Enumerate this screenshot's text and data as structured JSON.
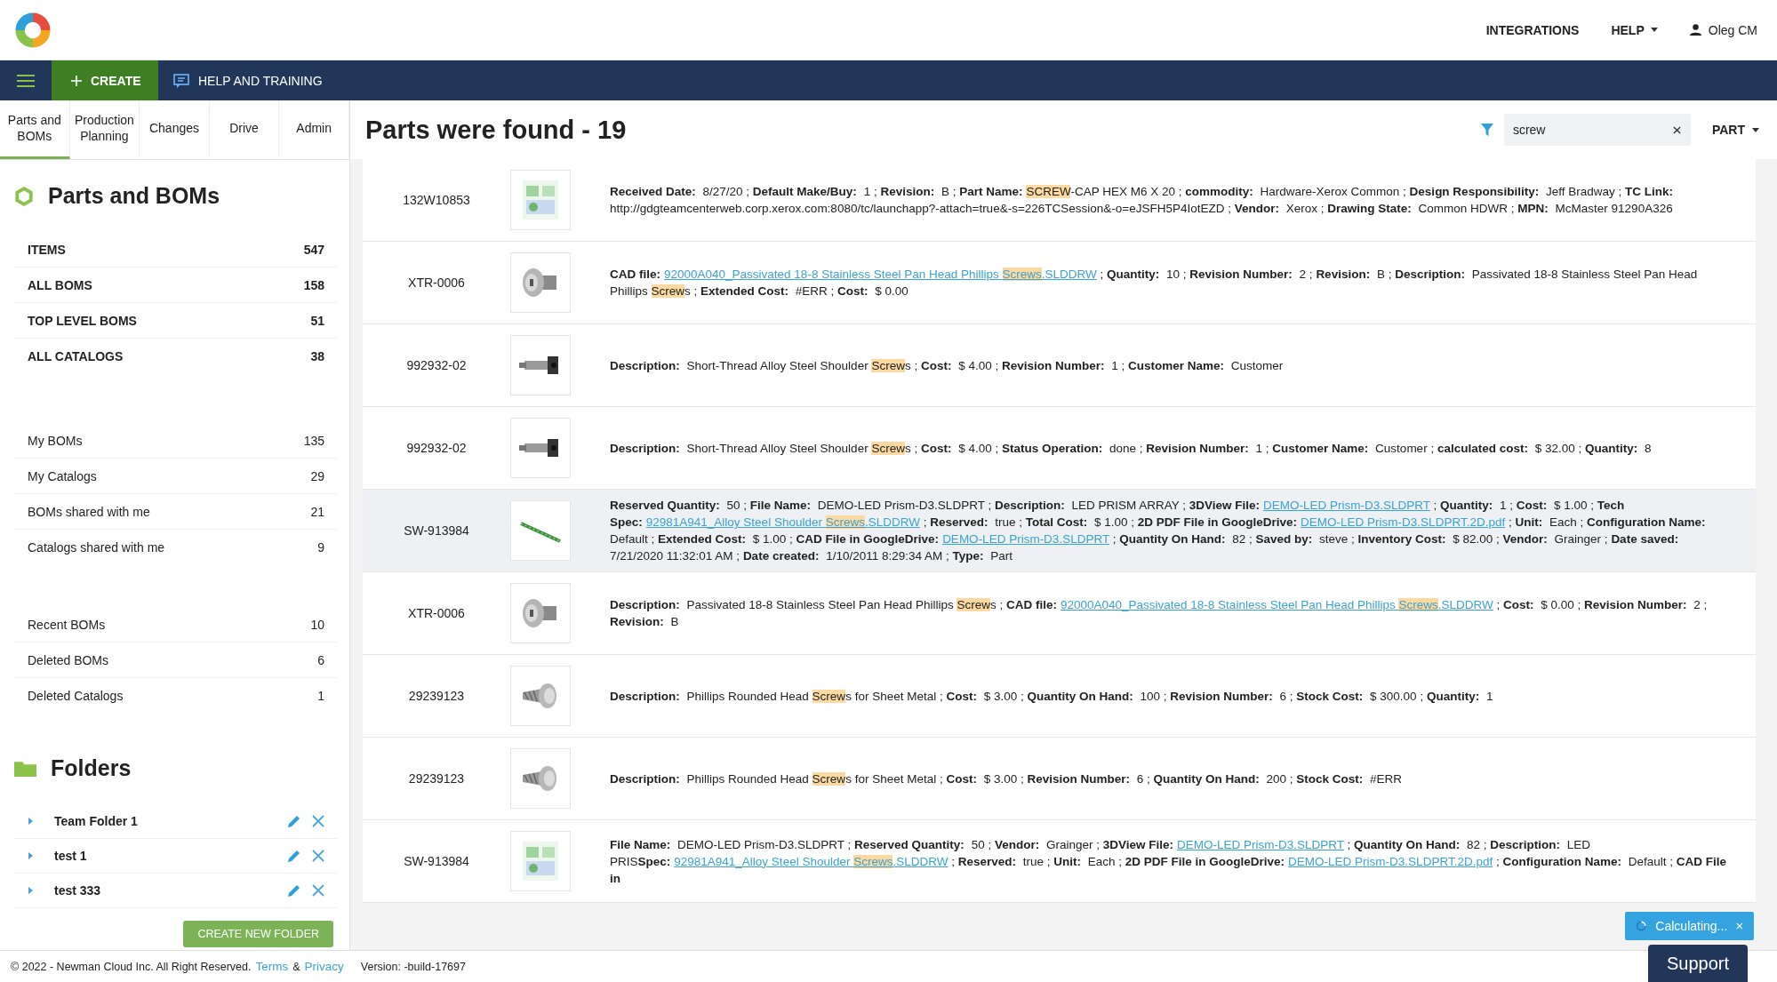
{
  "header": {
    "nav": [
      {
        "label": "INTEGRATIONS",
        "caret": false
      },
      {
        "label": "HELP",
        "caret": true
      }
    ],
    "user": "Oleg CM"
  },
  "toolbar": {
    "create": "CREATE",
    "help": "HELP AND TRAINING"
  },
  "tabs": [
    {
      "label": "Parts and BOMs",
      "selected": true
    },
    {
      "label": "Production Planning",
      "selected": false
    },
    {
      "label": "Changes",
      "selected": false
    },
    {
      "label": "Drive",
      "selected": false
    },
    {
      "label": "Admin",
      "selected": false
    }
  ],
  "sidebar": {
    "title": "Parts and BOMs",
    "groups": [
      {
        "kind": "main",
        "items": [
          {
            "label": "ITEMS",
            "count": "547"
          },
          {
            "label": "ALL BOMS",
            "count": "158"
          },
          {
            "label": "TOP LEVEL BOMS",
            "count": "51"
          },
          {
            "label": "ALL CATALOGS",
            "count": "38"
          }
        ]
      },
      {
        "kind": "plain",
        "items": [
          {
            "label": "My BOMs",
            "count": "135"
          },
          {
            "label": "My Catalogs",
            "count": "29"
          },
          {
            "label": "BOMs shared with me",
            "count": "21"
          },
          {
            "label": "Catalogs shared with me",
            "count": "9"
          }
        ]
      },
      {
        "kind": "plain",
        "items": [
          {
            "label": "Recent BOMs",
            "count": "10"
          },
          {
            "label": "Deleted BOMs",
            "count": "6"
          },
          {
            "label": "Deleted Catalogs",
            "count": "1"
          }
        ]
      }
    ],
    "folders_title": "Folders",
    "folders": [
      {
        "name": "Team Folder 1"
      },
      {
        "name": "test 1"
      },
      {
        "name": "test 333"
      }
    ],
    "create_folder": "CREATE NEW FOLDER"
  },
  "results": {
    "title": "Parts were found - 19",
    "search": "screw",
    "type": "PART",
    "rows": [
      {
        "number": "132W10853",
        "selected": false,
        "details": [
          {
            "kind": "label",
            "text": "Received Date:"
          },
          {
            "kind": "text",
            "text": " 8/27/20 ; "
          },
          {
            "kind": "label",
            "text": "Default Make/Buy:"
          },
          {
            "kind": "text",
            "text": " 1 ; "
          },
          {
            "kind": "label",
            "text": "Revision:"
          },
          {
            "kind": "text",
            "text": " B ; "
          },
          {
            "kind": "label",
            "text": "Part Name:"
          },
          {
            "kind": "hl",
            "text": "SCREW"
          },
          {
            "kind": "text",
            "text": "-CAP HEX M6 X 20 ; "
          },
          {
            "kind": "label",
            "text": "commodity:"
          },
          {
            "kind": "text",
            "text": " Hardware-Xerox Common ; "
          },
          {
            "kind": "label",
            "text": "Design Responsibility:"
          },
          {
            "kind": "text",
            "text": " Jeff Bradway ; "
          },
          {
            "kind": "label",
            "text": "TC Link:"
          },
          {
            "kind": "text",
            "text": " http://gdgteamcenterweb.corp.xerox.com:8080/tc/launchapp?-attach=true&-s=226TCSession&-o=eJSFH5P4IotEZD ; "
          },
          {
            "kind": "label",
            "text": "Vendor:"
          },
          {
            "kind": "text",
            "text": " Xerox ; "
          },
          {
            "kind": "label",
            "text": "Drawing State:"
          },
          {
            "kind": "text",
            "text": " Common HDWR ; "
          },
          {
            "kind": "label",
            "text": "MPN:"
          },
          {
            "kind": "text",
            "text": " McMaster 91290A326"
          }
        ]
      },
      {
        "number": "XTR-0006",
        "selected": false,
        "details": [
          {
            "kind": "label",
            "text": "CAD file:"
          },
          {
            "kind": "link",
            "parts": [
              {
                "text": "92000A040_Passivated 18-8 Stainless Steel Pan Head Phillips ",
                "highlight": false
              },
              {
                "text": "Screws",
                "highlight": true
              },
              {
                "text": ".SLDDRW",
                "highlight": false
              }
            ]
          },
          {
            "kind": "text",
            "text": " ; "
          },
          {
            "kind": "label",
            "text": "Quantity:"
          },
          {
            "kind": "text",
            "text": " 10 ; "
          },
          {
            "kind": "label",
            "text": "Revision Number:"
          },
          {
            "kind": "text",
            "text": " 2 ; "
          },
          {
            "kind": "label",
            "text": "Revision:"
          },
          {
            "kind": "text",
            "text": " B ; "
          },
          {
            "kind": "label",
            "text": "Description:"
          },
          {
            "kind": "text",
            "text": " Passivated 18-8 Stainless Steel Pan Head Phillips "
          },
          {
            "kind": "hl",
            "text": "Screw"
          },
          {
            "kind": "text",
            "text": "s ; "
          },
          {
            "kind": "label",
            "text": "Extended Cost:"
          },
          {
            "kind": "text",
            "text": " #ERR ; "
          },
          {
            "kind": "label",
            "text": "Cost:"
          },
          {
            "kind": "text",
            "text": " $ 0.00"
          }
        ]
      },
      {
        "number": "992932-02",
        "selected": false,
        "details": [
          {
            "kind": "label",
            "text": "Description:"
          },
          {
            "kind": "text",
            "text": " Short-Thread Alloy Steel Shoulder "
          },
          {
            "kind": "hl",
            "text": "Screw"
          },
          {
            "kind": "text",
            "text": "s ; "
          },
          {
            "kind": "label",
            "text": "Cost:"
          },
          {
            "kind": "text",
            "text": " $ 4.00 ; "
          },
          {
            "kind": "label",
            "text": "Revision Number:"
          },
          {
            "kind": "text",
            "text": " 1 ; "
          },
          {
            "kind": "label",
            "text": "Customer Name:"
          },
          {
            "kind": "text",
            "text": " Customer"
          }
        ]
      },
      {
        "number": "992932-02",
        "selected": false,
        "details": [
          {
            "kind": "label",
            "text": "Description:"
          },
          {
            "kind": "text",
            "text": " Short-Thread Alloy Steel Shoulder "
          },
          {
            "kind": "hl",
            "text": "Screw"
          },
          {
            "kind": "text",
            "text": "s ; "
          },
          {
            "kind": "label",
            "text": "Cost:"
          },
          {
            "kind": "text",
            "text": " $ 4.00 ; "
          },
          {
            "kind": "label",
            "text": "Status Operation:"
          },
          {
            "kind": "text",
            "text": " done ; "
          },
          {
            "kind": "label",
            "text": "Revision Number:"
          },
          {
            "kind": "text",
            "text": " 1 ; "
          },
          {
            "kind": "label",
            "text": "Customer Name:"
          },
          {
            "kind": "text",
            "text": " Customer ; "
          },
          {
            "kind": "label",
            "text": "calculated cost:"
          },
          {
            "kind": "text",
            "text": " $ 32.00 ; "
          },
          {
            "kind": "label",
            "text": "Quantity:"
          },
          {
            "kind": "text",
            "text": " 8"
          }
        ]
      },
      {
        "number": "SW-913984",
        "selected": true,
        "details": [
          {
            "kind": "label",
            "text": "Reserved Quantity:"
          },
          {
            "kind": "text",
            "text": " 50 ; "
          },
          {
            "kind": "label",
            "text": "File Name:"
          },
          {
            "kind": "text",
            "text": " DEMO-LED Prism-D3.SLDPRT ; "
          },
          {
            "kind": "label",
            "text": "Description:"
          },
          {
            "kind": "text",
            "text": " LED PRISM ARRAY ; "
          },
          {
            "kind": "label",
            "text": "3DView File:"
          },
          {
            "kind": "link",
            "parts": [
              {
                "text": "DEMO-LED Prism-D3.SLDPRT",
                "highlight": false
              }
            ]
          },
          {
            "kind": "text",
            "text": " ; "
          },
          {
            "kind": "label",
            "text": "Quantity:"
          },
          {
            "kind": "text",
            "text": " 1 ; "
          },
          {
            "kind": "label",
            "text": "Cost:"
          },
          {
            "kind": "text",
            "text": " $ 1.00 ; "
          },
          {
            "kind": "label",
            "text": "Tech Spec:"
          },
          {
            "kind": "link",
            "parts": [
              {
                "text": "92981A941_Alloy Steel Shoulder ",
                "highlight": false
              },
              {
                "text": "Screws",
                "highlight": true
              },
              {
                "text": ".SLDDRW",
                "highlight": false
              }
            ]
          },
          {
            "kind": "text",
            "text": " ; "
          },
          {
            "kind": "label",
            "text": "Reserved:"
          },
          {
            "kind": "text",
            "text": " true ; "
          },
          {
            "kind": "label",
            "text": "Total Cost:"
          },
          {
            "kind": "text",
            "text": " $ 1.00 ; "
          },
          {
            "kind": "label",
            "text": "2D PDF File in GoogleDrive:"
          },
          {
            "kind": "link",
            "parts": [
              {
                "text": "DEMO-LED Prism-D3.SLDPRT.2D.pdf",
                "highlight": false
              }
            ]
          },
          {
            "kind": "text",
            "text": " ; "
          },
          {
            "kind": "label",
            "text": "Unit:"
          },
          {
            "kind": "text",
            "text": " Each ; "
          },
          {
            "kind": "label",
            "text": "Configuration Name:"
          },
          {
            "kind": "text",
            "text": " Default ; "
          },
          {
            "kind": "label",
            "text": "Extended Cost:"
          },
          {
            "kind": "text",
            "text": " $ 1.00 ; "
          },
          {
            "kind": "label",
            "text": "CAD File in GoogleDrive:"
          },
          {
            "kind": "link",
            "parts": [
              {
                "text": "DEMO-LED Prism-D3.SLDPRT",
                "highlight": false
              }
            ]
          },
          {
            "kind": "text",
            "text": " ; "
          },
          {
            "kind": "label",
            "text": "Quantity On Hand:"
          },
          {
            "kind": "text",
            "text": " 82 ; "
          },
          {
            "kind": "label",
            "text": "Saved by:"
          },
          {
            "kind": "text",
            "text": " steve ; "
          },
          {
            "kind": "label",
            "text": "Inventory Cost:"
          },
          {
            "kind": "text",
            "text": " $ 82.00 ; "
          },
          {
            "kind": "label",
            "text": "Vendor:"
          },
          {
            "kind": "text",
            "text": " Grainger ; "
          },
          {
            "kind": "label",
            "text": "Date saved:"
          },
          {
            "kind": "text",
            "text": " 7/21/2020 11:32:01 AM ; "
          },
          {
            "kind": "label",
            "text": "Date created:"
          },
          {
            "kind": "text",
            "text": " 1/10/2011 8:29:34 AM ; "
          },
          {
            "kind": "label",
            "text": "Type:"
          },
          {
            "kind": "text",
            "text": " Part"
          }
        ]
      },
      {
        "number": "XTR-0006",
        "selected": false,
        "details": [
          {
            "kind": "label",
            "text": "Description:"
          },
          {
            "kind": "text",
            "text": " Passivated 18-8 Stainless Steel Pan Head Phillips "
          },
          {
            "kind": "hl",
            "text": "Screw"
          },
          {
            "kind": "text",
            "text": "s ; "
          },
          {
            "kind": "label",
            "text": "CAD file:"
          },
          {
            "kind": "link",
            "parts": [
              {
                "text": "92000A040_Passivated 18-8 Stainless Steel Pan Head Phillips ",
                "highlight": false
              },
              {
                "text": "Screws",
                "highlight": true
              },
              {
                "text": ".SLDDRW",
                "highlight": false
              }
            ]
          },
          {
            "kind": "text",
            "text": " ; "
          },
          {
            "kind": "label",
            "text": "Cost:"
          },
          {
            "kind": "text",
            "text": " $ 0.00 ; "
          },
          {
            "kind": "label",
            "text": "Revision Number:"
          },
          {
            "kind": "text",
            "text": " 2 ; "
          },
          {
            "kind": "label",
            "text": "Revision:"
          },
          {
            "kind": "text",
            "text": " B"
          }
        ]
      },
      {
        "number": "29239123",
        "selected": false,
        "details": [
          {
            "kind": "label",
            "text": "Description:"
          },
          {
            "kind": "text",
            "text": " Phillips Rounded Head "
          },
          {
            "kind": "hl",
            "text": "Screw"
          },
          {
            "kind": "text",
            "text": "s for Sheet Metal ; "
          },
          {
            "kind": "label",
            "text": "Cost:"
          },
          {
            "kind": "text",
            "text": " $ 3.00 ; "
          },
          {
            "kind": "label",
            "text": "Quantity On Hand:"
          },
          {
            "kind": "text",
            "text": " 100 ; "
          },
          {
            "kind": "label",
            "text": "Revision Number:"
          },
          {
            "kind": "text",
            "text": " 6 ; "
          },
          {
            "kind": "label",
            "text": "Stock Cost:"
          },
          {
            "kind": "text",
            "text": " $ 300.00 ; "
          },
          {
            "kind": "label",
            "text": "Quantity:"
          },
          {
            "kind": "text",
            "text": " 1"
          }
        ]
      },
      {
        "number": "29239123",
        "selected": false,
        "details": [
          {
            "kind": "label",
            "text": "Description:"
          },
          {
            "kind": "text",
            "text": " Phillips Rounded Head "
          },
          {
            "kind": "hl",
            "text": "Screw"
          },
          {
            "kind": "text",
            "text": "s for Sheet Metal ; "
          },
          {
            "kind": "label",
            "text": "Cost:"
          },
          {
            "kind": "text",
            "text": " $ 3.00 ; "
          },
          {
            "kind": "label",
            "text": "Revision Number:"
          },
          {
            "kind": "text",
            "text": " 6 ; "
          },
          {
            "kind": "label",
            "text": "Quantity On Hand:"
          },
          {
            "kind": "text",
            "text": " 200 ; "
          },
          {
            "kind": "label",
            "text": "Stock Cost:"
          },
          {
            "kind": "text",
            "text": " #ERR"
          }
        ]
      },
      {
        "number": "SW-913984",
        "selected": false,
        "details": [
          {
            "kind": "label",
            "text": "File Name:"
          },
          {
            "kind": "text",
            "text": " DEMO-LED Prism-D3.SLDPRT ; "
          },
          {
            "kind": "label",
            "text": "Reserved Quantity:"
          },
          {
            "kind": "text",
            "text": " 50 ; "
          },
          {
            "kind": "label",
            "text": "Vendor:"
          },
          {
            "kind": "text",
            "text": " Grainger ; "
          },
          {
            "kind": "label",
            "text": "3DView File:"
          },
          {
            "kind": "link",
            "parts": [
              {
                "text": "DEMO-LED Prism-D3.SLDPRT",
                "highlight": false
              }
            ]
          },
          {
            "kind": "text",
            "text": " ; "
          },
          {
            "kind": "label",
            "text": "Quantity On Hand:"
          },
          {
            "kind": "text",
            "text": " 82 ; "
          },
          {
            "kind": "label",
            "text": "Description:"
          },
          {
            "kind": "text",
            "text": " LED PRIS"
          },
          {
            "kind": "label",
            "text": "Spec:"
          },
          {
            "kind": "link",
            "parts": [
              {
                "text": "92981A941_Alloy Steel Shoulder ",
                "highlight": false
              },
              {
                "text": "Screws",
                "highlight": true
              },
              {
                "text": ".SLDDRW",
                "highlight": false
              }
            ]
          },
          {
            "kind": "text",
            "text": " ; "
          },
          {
            "kind": "label",
            "text": "Reserved:"
          },
          {
            "kind": "text",
            "text": " true ; "
          },
          {
            "kind": "label",
            "text": "Unit:"
          },
          {
            "kind": "text",
            "text": " Each ; "
          },
          {
            "kind": "label",
            "text": "2D PDF File in GoogleDrive:"
          },
          {
            "kind": "link",
            "parts": [
              {
                "text": "DEMO-LED Prism-D3.SLDPRT.2D.pdf",
                "highlight": false
              }
            ]
          },
          {
            "kind": "text",
            "text": " ; "
          },
          {
            "kind": "label",
            "text": "Configuration Name:"
          },
          {
            "kind": "text",
            "text": " Default ; "
          },
          {
            "kind": "label",
            "text": "CAD File in"
          }
        ]
      }
    ]
  },
  "footer": {
    "copyright": "© 2022 - Newman Cloud Inc. All Right Reserved.",
    "terms": "Terms",
    "amp": "&",
    "privacy": "Privacy",
    "version": "Version: -build-17697"
  },
  "toast": "Calculating...",
  "support": "Support"
}
